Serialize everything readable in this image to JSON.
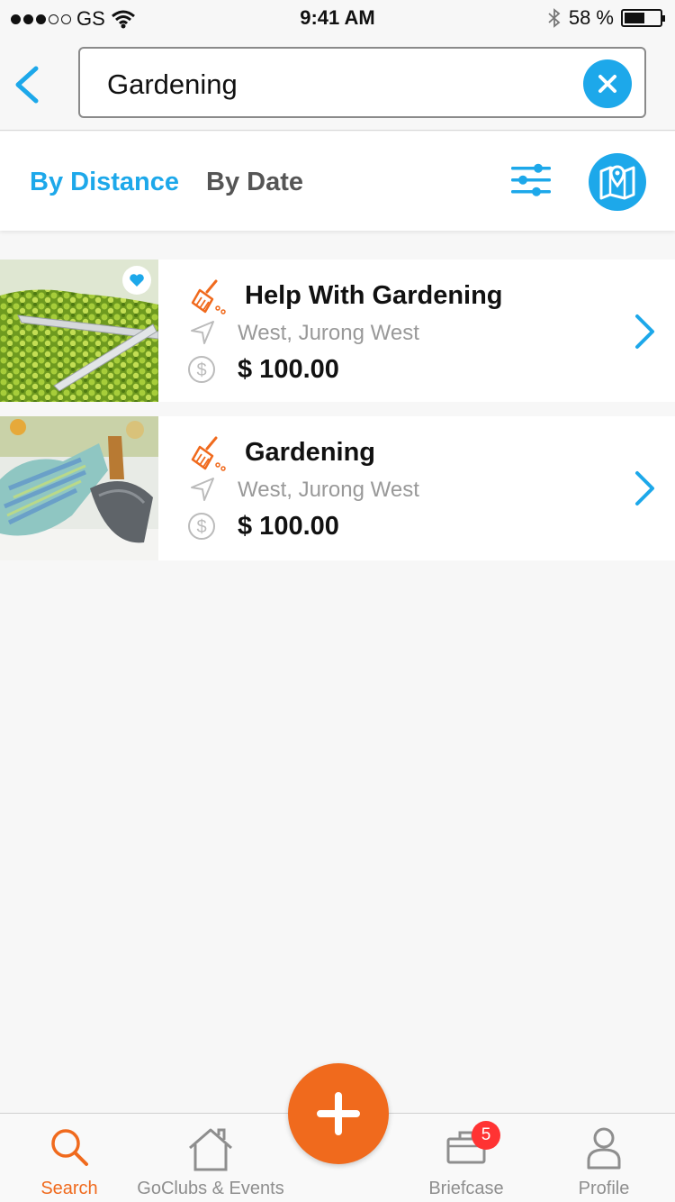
{
  "status_bar": {
    "carrier": "GS",
    "time": "9:41 AM",
    "battery": "58 %",
    "battery_level": 0.58
  },
  "search": {
    "query": "Gardening",
    "icons": {
      "back": "chevron-left-icon",
      "clear": "close-icon"
    }
  },
  "sort_bar": {
    "tabs": [
      {
        "label": "By Distance",
        "active": true
      },
      {
        "label": "By Date",
        "active": false
      }
    ],
    "icons": {
      "filter": "sliders-icon",
      "map": "map-pin-icon"
    }
  },
  "results": [
    {
      "title": "Help With Gardening",
      "location": "West, Jurong West",
      "price": "$ 100.00",
      "favorited": true,
      "category_icon": "broom-icon"
    },
    {
      "title": "Gardening",
      "location": "West, Jurong West",
      "price": "$ 100.00",
      "favorited": false,
      "category_icon": "broom-icon"
    }
  ],
  "bottom_nav": {
    "items": [
      {
        "label": "Search",
        "icon": "search-icon",
        "active": true
      },
      {
        "label": "GoClubs & Events",
        "icon": "home-icon",
        "active": false
      },
      {
        "label": "Briefcase",
        "icon": "briefcase-icon",
        "active": false,
        "badge": "5"
      },
      {
        "label": "Profile",
        "icon": "person-icon",
        "active": false
      }
    ],
    "fab_icon": "plus-icon"
  },
  "colors": {
    "accent_blue": "#1da8ea",
    "accent_orange": "#f06a1d",
    "badge_red": "#ff3333"
  }
}
